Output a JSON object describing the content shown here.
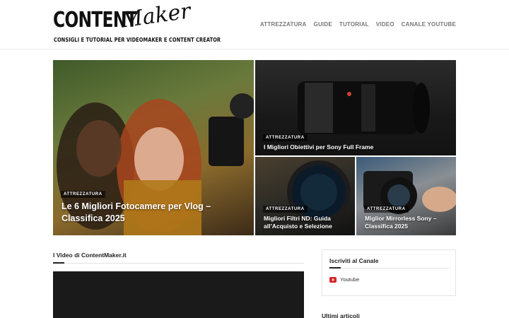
{
  "header": {
    "logo": {
      "main": "CONTENT",
      "script": "Maker",
      "tagline": "CONSIGLI E TUTORIAL PER VIDEOMAKER E CONTENT CREATOR"
    },
    "nav": [
      "ATTREZZATURA",
      "GUIDE",
      "TUTORIAL",
      "VIDEO",
      "CANALE YOUTUBE"
    ]
  },
  "featured": [
    {
      "category": "ATTREZZATURA",
      "title": "Le 6 Migliori Fotocamere per Vlog – Classifica 2025"
    },
    {
      "category": "ATTREZZATURA",
      "title": "I Migliori Obiettivi per Sony Full Frame"
    },
    {
      "category": "ATTREZZATURA",
      "title": "Migliori Filtri ND: Guida all’Acquisto e Selezione"
    },
    {
      "category": "ATTREZZATURA",
      "title": "Miglior Mirrorless Sony – Classifica 2025"
    }
  ],
  "videos_section": {
    "title": "I Video di ContentMaker.it"
  },
  "subscribe_widget": {
    "title": "Iscriviti al Canale",
    "link": "Youtube"
  },
  "latest": {
    "title": "Ultimi articoli"
  },
  "colors": {
    "youtube_red": "#d62828",
    "nav_text": "#777777"
  }
}
